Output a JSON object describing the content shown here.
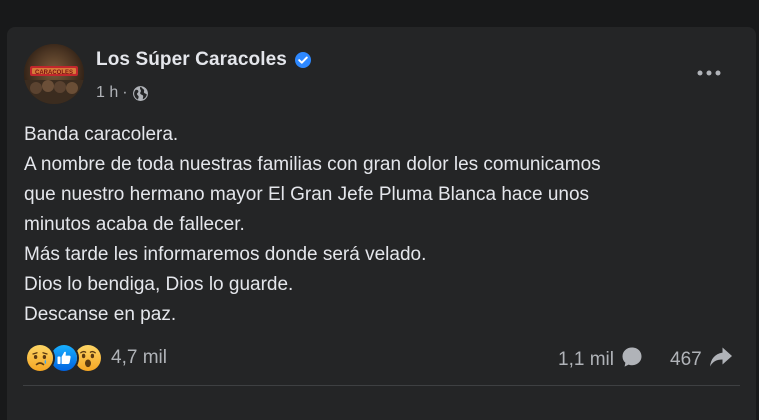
{
  "post": {
    "author": "Los Súper Caracoles",
    "time": "1 h",
    "separator": "·",
    "avatar_logo_text": "CARACOLES",
    "text_lines": [
      "Banda caracolera.",
      "A nombre de toda nuestras familias con gran dolor les comunicamos",
      "que nuestro hermano mayor El Gran Jefe Pluma Blanca hace unos",
      "minutos acaba de fallecer.",
      "Más tarde les informaremos donde será velado.",
      "Dios lo bendiga, Dios lo guarde.",
      "Descanse en paz."
    ]
  },
  "stats": {
    "reactions_count": "4,7 mil",
    "comments_count": "1,1 mil",
    "shares_count": "467"
  },
  "icons": {
    "verified": "verified-badge-icon",
    "audience": "globe-icon",
    "more": "more-options-icon",
    "reactions": [
      "sad-reaction-icon",
      "like-reaction-icon",
      "wow-reaction-icon"
    ],
    "comment": "comment-bubble-icon",
    "share": "share-arrow-icon"
  },
  "colors": {
    "background": "#18191a",
    "card": "#242526",
    "primary_text": "#e4e6eb",
    "secondary_text": "#b0b3b8",
    "verified_blue": "#2d88ff",
    "like_blue": "#1877f2",
    "reaction_yellow": "#f7b125"
  }
}
